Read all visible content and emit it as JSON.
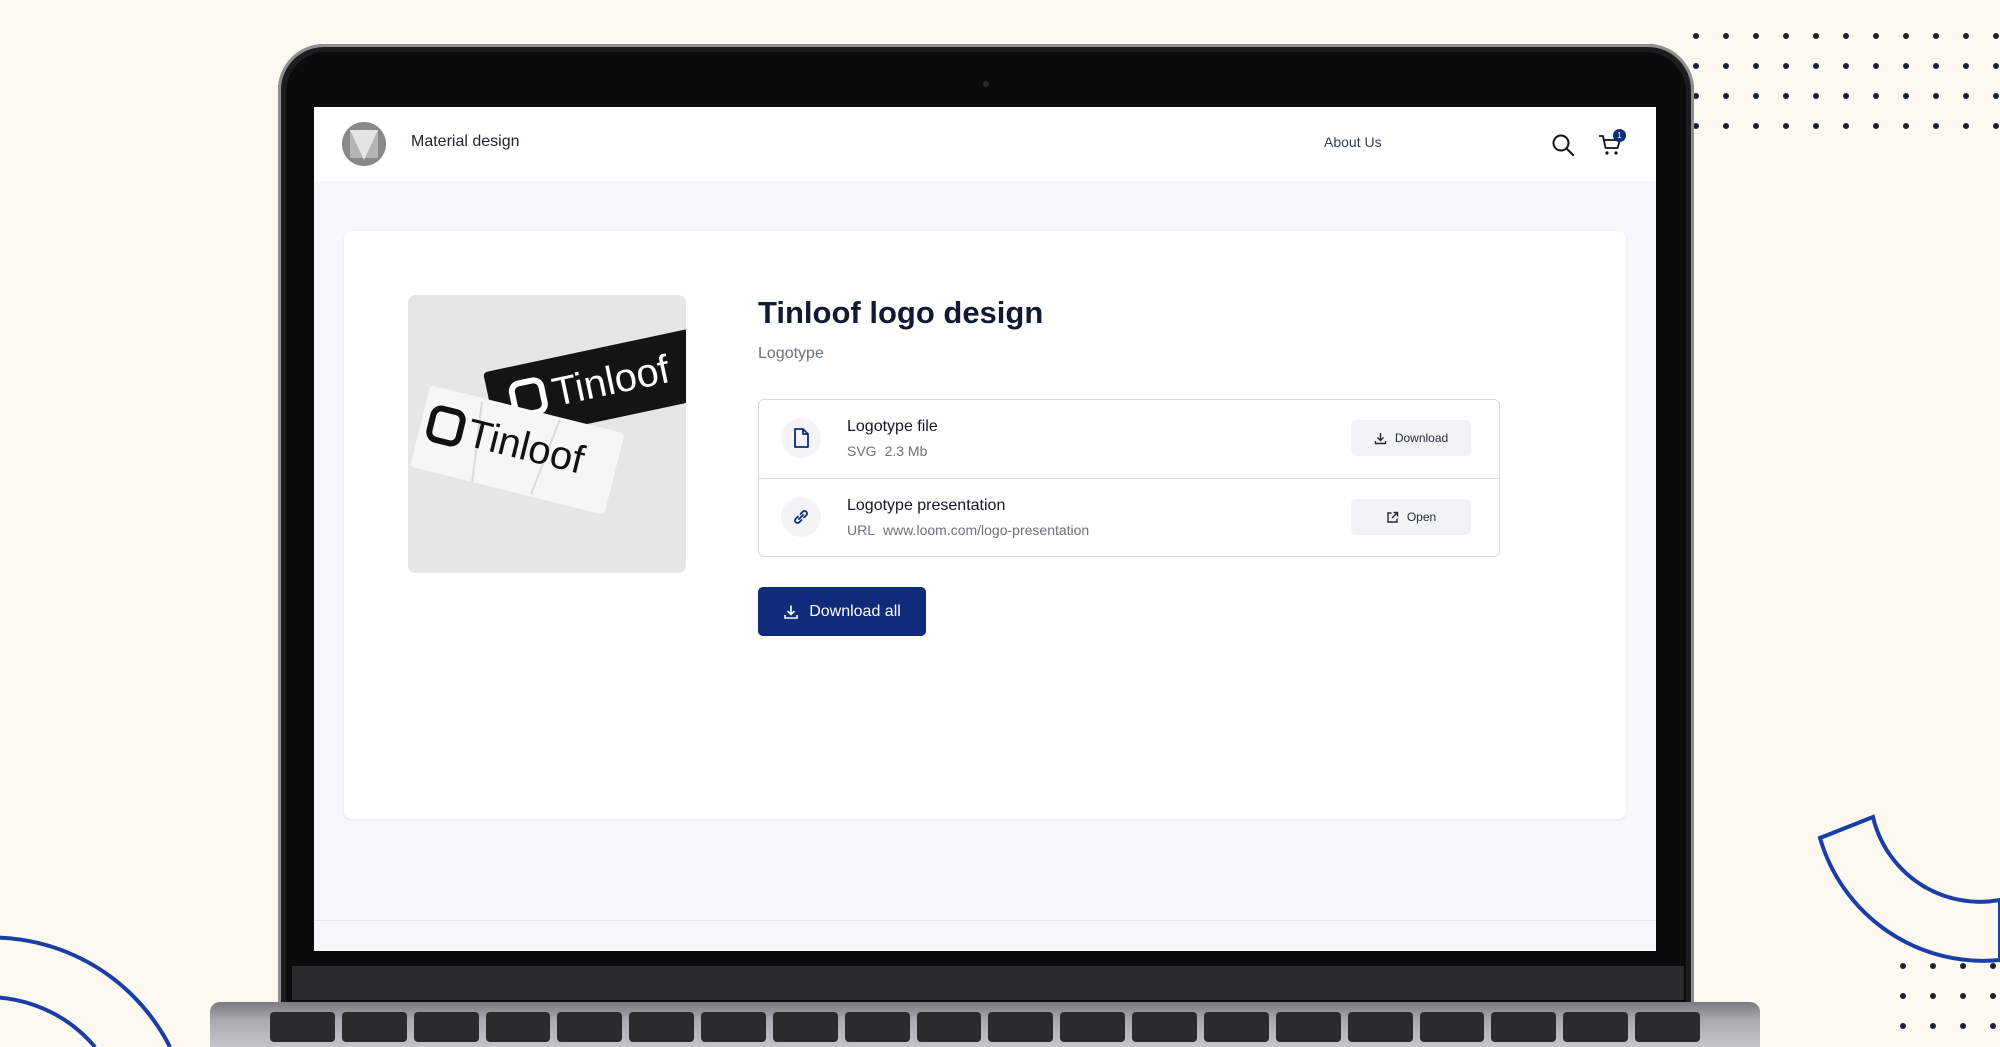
{
  "nav": {
    "brand": "Material design",
    "about": "About Us",
    "cart_count": "1"
  },
  "product": {
    "title": "Tinloof logo design",
    "subtitle": "Logotype",
    "image_alt_text": [
      "Tinloof",
      "Tinloof"
    ]
  },
  "files": [
    {
      "name": "Logotype file",
      "type": "SVG",
      "detail": "2.3 Mb",
      "action": "Download",
      "icon": "file-icon",
      "action_icon": "download-icon"
    },
    {
      "name": "Logotype presentation",
      "type": "URL",
      "detail": "www.loom.com/logo-presentation",
      "action": "Open",
      "icon": "link-icon",
      "action_icon": "external-link-icon"
    }
  ],
  "actions": {
    "download_all": "Download all"
  },
  "colors": {
    "primary": "#0f2b7a",
    "background": "#fdf9f0",
    "decoration": "#1a3ea6"
  }
}
